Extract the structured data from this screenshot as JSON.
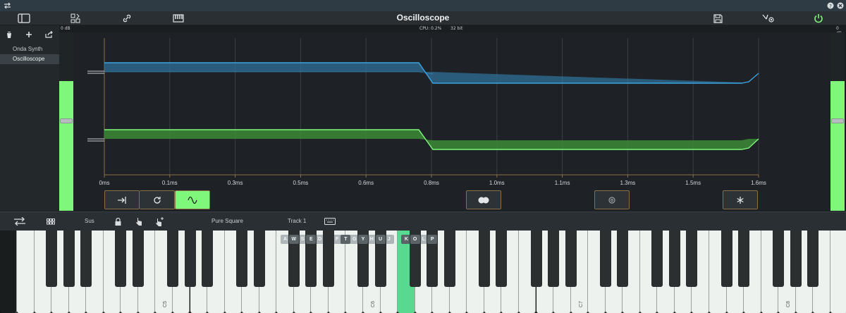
{
  "app": {
    "title": "Oscilloscope"
  },
  "status": {
    "cpu": "CPU: 0.2%",
    "bits": "32 bit",
    "db_left": "0 dB",
    "db_right": "0 dB"
  },
  "sidebar": {
    "items": [
      {
        "label": "Onda Synth"
      },
      {
        "label": "Oscilloscope"
      }
    ]
  },
  "scope": {
    "x_ticks": [
      "0ms",
      "0.1ms",
      "0.3ms",
      "0.5ms",
      "0.6ms",
      "0.8ms",
      "1.0ms",
      "1.1ms",
      "1.3ms",
      "1.5ms",
      "1.6ms"
    ],
    "channel_colors": {
      "left": "#3aa3e0",
      "right": "#7ef77a"
    }
  },
  "keyboard": {
    "mode_label": "Sus",
    "preset_label": "Pure Square",
    "track_label": "Track 1",
    "key_hints_white": [
      "A",
      "S",
      "D",
      "F",
      "G",
      "H",
      "J",
      "K",
      "L"
    ],
    "key_hints_black": [
      "W",
      "E",
      "T",
      "Y",
      "U",
      "O",
      "P"
    ],
    "octaves": [
      "C5",
      "C6",
      "C7",
      "C8"
    ]
  },
  "colors": {
    "accent": "#7ef77a",
    "pressed_key": "#59d98f",
    "button_border": "#8a7047"
  }
}
